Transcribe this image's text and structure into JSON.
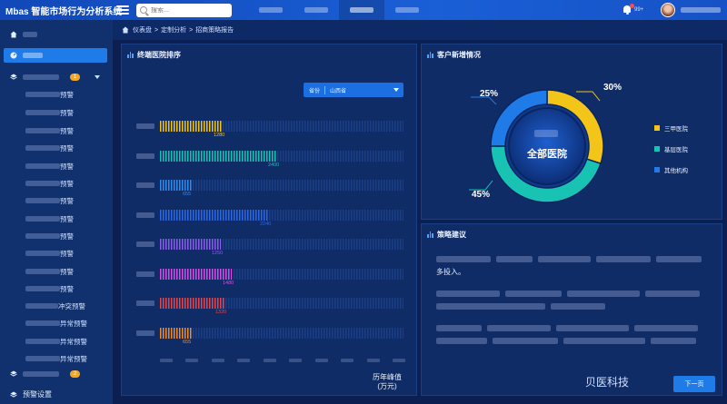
{
  "app": {
    "title": "Mbas 智能市场行为分析系统"
  },
  "search": {
    "placeholder": "搜索..."
  },
  "header": {
    "notification_count": "99+"
  },
  "breadcrumb": {
    "items": [
      "仪表盘",
      ">",
      "定制分析",
      ">",
      "招商策略报告"
    ]
  },
  "sidebar": {
    "submenu_suffixes": [
      "预警",
      "预警",
      "预警",
      "预警",
      "预警",
      "预警",
      "预警",
      "预警",
      "预警",
      "预警",
      "预警",
      "预警",
      "冲突预警",
      "异常预警",
      "异常预警",
      "异常预警"
    ],
    "badges": [
      "1",
      "2"
    ],
    "bottom_label": "预警设置"
  },
  "ranking_panel": {
    "title": "终端医院排序",
    "filter_label": "省份",
    "filter_value": "山西省",
    "peak_label_line1": "历年峰值",
    "peak_label_line2": "(万元)",
    "max": 5000,
    "rows": [
      {
        "value": 1280,
        "label": "1280",
        "color": "#f2c518"
      },
      {
        "value": 2400,
        "label": "2400",
        "color": "#19c3b4"
      },
      {
        "value": 655,
        "label": "655",
        "color": "#2e8ef0"
      },
      {
        "value": 2240,
        "label": "2240",
        "color": "#2a68e8"
      },
      {
        "value": 1250,
        "label": "1250",
        "color": "#8c5cf0"
      },
      {
        "value": 1480,
        "label": "1480",
        "color": "#d84ce8"
      },
      {
        "value": 1320,
        "label": "1320",
        "color": "#e8454a"
      },
      {
        "value": 655,
        "label": "655",
        "color": "#f08a2a"
      }
    ]
  },
  "customer_panel": {
    "title": "客户新增情况",
    "center_label": "全部医院",
    "chart_data": {
      "type": "pie",
      "categories": [
        "三甲医院",
        "基层医院",
        "其他机构"
      ],
      "values": [
        30,
        45,
        25
      ],
      "labels": [
        "30%",
        "45%",
        "25%"
      ],
      "colors": [
        "#f2c518",
        "#19c3b4",
        "#1e7be8"
      ]
    }
  },
  "advice_panel": {
    "title": "策略建议",
    "visible_text": "多投入。",
    "brand": "贝医科技",
    "next_button": "下一页"
  }
}
